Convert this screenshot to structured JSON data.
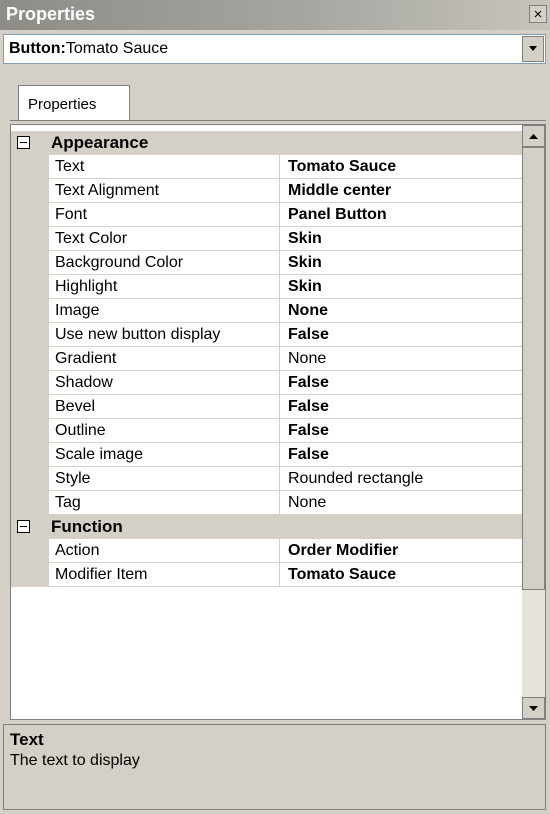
{
  "window": {
    "title": "Properties",
    "close_glyph": "×"
  },
  "object_selector": {
    "type_label": "Button:",
    "name": "Tomato Sauce"
  },
  "tabs": [
    {
      "label": "Properties",
      "active": true
    }
  ],
  "categories": [
    {
      "name": "Appearance",
      "expanded": true,
      "properties": [
        {
          "name": "Text",
          "value": "Tomato Sauce",
          "bold": true
        },
        {
          "name": "Text Alignment",
          "value": "Middle center",
          "bold": true
        },
        {
          "name": "Font",
          "value": "Panel Button",
          "bold": true
        },
        {
          "name": "Text Color",
          "value": "Skin",
          "bold": true
        },
        {
          "name": "Background Color",
          "value": "Skin",
          "bold": true
        },
        {
          "name": "Highlight",
          "value": "Skin",
          "bold": true
        },
        {
          "name": "Image",
          "value": "None",
          "bold": true
        },
        {
          "name": "Use new button display",
          "value": "False",
          "bold": true
        },
        {
          "name": "Gradient",
          "value": "None",
          "bold": false
        },
        {
          "name": "Shadow",
          "value": "False",
          "bold": true
        },
        {
          "name": "Bevel",
          "value": "False",
          "bold": true
        },
        {
          "name": "Outline",
          "value": "False",
          "bold": true
        },
        {
          "name": "Scale image",
          "value": "False",
          "bold": true
        },
        {
          "name": "Style",
          "value": "Rounded rectangle",
          "bold": false
        },
        {
          "name": "Tag",
          "value": "None",
          "bold": false
        }
      ]
    },
    {
      "name": "Function",
      "expanded": true,
      "properties": [
        {
          "name": "Action",
          "value": "Order Modifier",
          "bold": true
        },
        {
          "name": "Modifier Item",
          "value": "Tomato Sauce",
          "bold": true
        }
      ]
    }
  ],
  "description": {
    "title": "Text",
    "text": "The text to display"
  },
  "icons": {
    "close": "close-icon",
    "dropdown": "chevron-down-icon",
    "collapse": "minus-box-icon",
    "scroll_up": "arrow-up-icon",
    "scroll_down": "arrow-down-icon"
  },
  "colors": {
    "panel_bg": "#d4d0c8",
    "title_gradient_start": "#8d8c87",
    "title_gradient_end": "#c6c4bd",
    "combo_border": "#7f9db9"
  }
}
